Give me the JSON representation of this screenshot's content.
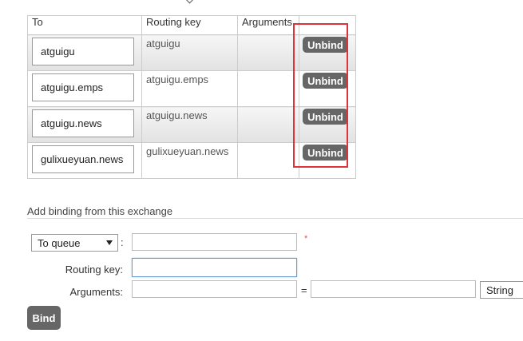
{
  "bindings_table": {
    "headers": {
      "to": "To",
      "routing_key": "Routing key",
      "arguments": "Arguments",
      "action": ""
    },
    "rows": [
      {
        "to": "atguigu",
        "routing_key": "atguigu",
        "arguments": "",
        "action": "Unbind"
      },
      {
        "to": "atguigu.emps",
        "routing_key": "atguigu.emps",
        "arguments": "",
        "action": "Unbind"
      },
      {
        "to": "atguigu.news",
        "routing_key": "atguigu.news",
        "arguments": "",
        "action": "Unbind"
      },
      {
        "to": "gulixueyuan.news",
        "routing_key": "gulixueyuan.news",
        "arguments": "",
        "action": "Unbind"
      }
    ]
  },
  "add_binding": {
    "title": "Add binding from this exchange",
    "destination_type": "To queue",
    "destination_colon": ":",
    "destination_value": "",
    "required_mark": "*",
    "routing_key_label": "Routing key:",
    "routing_key_value": "",
    "arguments_label": "Arguments:",
    "argument_key": "",
    "equals": "=",
    "argument_value": "",
    "argument_type": "String",
    "bind_label": "Bind"
  },
  "colors": {
    "button": "#666666",
    "highlight": "#e0323a",
    "focus": "#6c9bd2"
  }
}
